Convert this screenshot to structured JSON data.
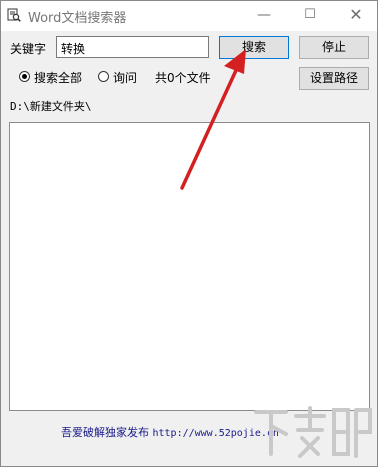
{
  "window": {
    "title": "Word文档搜索器",
    "minimize_glyph": "—",
    "maximize_glyph": "☐",
    "close_glyph": "✕"
  },
  "search": {
    "keyword_label": "关键字",
    "keyword_value": "转换",
    "search_button": "搜索",
    "stop_button": "停止",
    "set_path_button": "设置路径"
  },
  "options": {
    "search_all_label": "搜索全部",
    "query_label": "询问",
    "selected": "search_all",
    "file_count_text": "共0个文件"
  },
  "path_text": "D:\\新建文件夹\\",
  "results": [],
  "footer": {
    "publisher_text": "吾爱破解独家发布",
    "url": "http://www.52pojie.cn"
  },
  "annotation": {
    "arrow_color": "#d42020"
  },
  "watermark": {
    "text": "下载吧"
  }
}
